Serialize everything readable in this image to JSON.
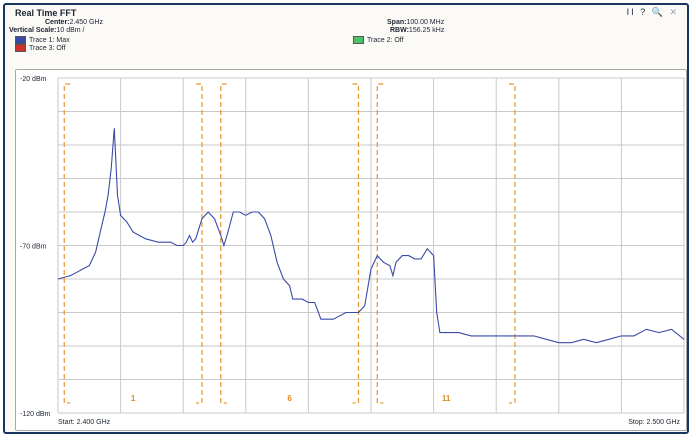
{
  "window": {
    "title": "Real Time FFT",
    "controls": [
      "II",
      "?",
      "🔍",
      "✕"
    ]
  },
  "info": {
    "center_label": "Center:",
    "center_value": "2.450 GHz",
    "vscale_label": "Vertical Scale:",
    "vscale_value": "10 dBm /",
    "span_label": "Span:",
    "span_value": "100.00 MHz",
    "rbw_label": "RBW:",
    "rbw_value": "156.25 kHz",
    "trace1": "Trace 1: Max",
    "trace2": "Trace 2: Off",
    "trace3": "Trace 3: Off",
    "colors": {
      "trace1": "#3a4aa8",
      "trace2": "#4fbf6a",
      "trace3": "#d0302a"
    }
  },
  "plot": {
    "start_label": "Start: 2.400 GHz",
    "stop_label": "Stop: 2.500 GHz"
  },
  "chart_data": {
    "type": "line",
    "x_unit": "GHz",
    "xlim": [
      2.4,
      2.5
    ],
    "ylim": [
      -120,
      -20
    ],
    "ytick_labels": [
      "-20 dBm",
      "-70 dBm",
      "-120 dBm"
    ],
    "yticks": [
      -20,
      -70,
      -120
    ],
    "grid": true,
    "channels": [
      {
        "label": "1",
        "x_start": 2.401,
        "x_end": 2.423
      },
      {
        "label": "6",
        "x_start": 2.426,
        "x_end": 2.448
      },
      {
        "label": "11",
        "x_start": 2.451,
        "x_end": 2.473
      }
    ],
    "series": [
      {
        "name": "Trace 1: Max",
        "color": "#3a4aa8",
        "x": [
          2.4,
          2.402,
          2.403,
          2.404,
          2.405,
          2.406,
          2.407,
          2.4075,
          2.408,
          2.4085,
          2.409,
          2.4095,
          2.41,
          2.411,
          2.412,
          2.414,
          2.416,
          2.418,
          2.419,
          2.42,
          2.4205,
          2.421,
          2.4215,
          2.422,
          2.423,
          2.424,
          2.425,
          2.426,
          2.4265,
          2.427,
          2.428,
          2.429,
          2.43,
          2.431,
          2.432,
          2.433,
          2.434,
          2.435,
          2.436,
          2.437,
          2.4375,
          2.438,
          2.439,
          2.44,
          2.441,
          2.442,
          2.443,
          2.444,
          2.445,
          2.446,
          2.447,
          2.448,
          2.449,
          2.45,
          2.451,
          2.452,
          2.453,
          2.4535,
          2.454,
          2.455,
          2.456,
          2.457,
          2.458,
          2.459,
          2.46,
          2.4605,
          2.461,
          2.462,
          2.4625,
          2.463,
          2.4635,
          2.464,
          2.466,
          2.468,
          2.47,
          2.472,
          2.474,
          2.476,
          2.478,
          2.48,
          2.482,
          2.484,
          2.486,
          2.488,
          2.49,
          2.492,
          2.494,
          2.496,
          2.498,
          2.5
        ],
        "y": [
          -80,
          -79,
          -78,
          -77,
          -76,
          -72,
          -64,
          -60,
          -55,
          -47,
          -35,
          -55,
          -61,
          -63,
          -66,
          -68,
          -69,
          -69,
          -70,
          -70,
          -69,
          -67,
          -69,
          -68,
          -62,
          -60,
          -62,
          -67,
          -70,
          -67,
          -60,
          -60,
          -61,
          -60,
          -60,
          -62,
          -67,
          -75,
          -80,
          -82,
          -86,
          -86,
          -86,
          -87,
          -87,
          -92,
          -92,
          -92,
          -91,
          -90,
          -90,
          -90,
          -88,
          -77,
          -73,
          -75,
          -76,
          -79,
          -75,
          -73,
          -73,
          -74,
          -74,
          -71,
          -73,
          -90,
          -96,
          -96,
          -96,
          -96,
          -96,
          -96,
          -97,
          -97,
          -97,
          -97,
          -97,
          -97,
          -98,
          -99,
          -99,
          -98,
          -99,
          -98,
          -97,
          -97,
          -95,
          -96,
          -95,
          -98
        ]
      }
    ]
  }
}
